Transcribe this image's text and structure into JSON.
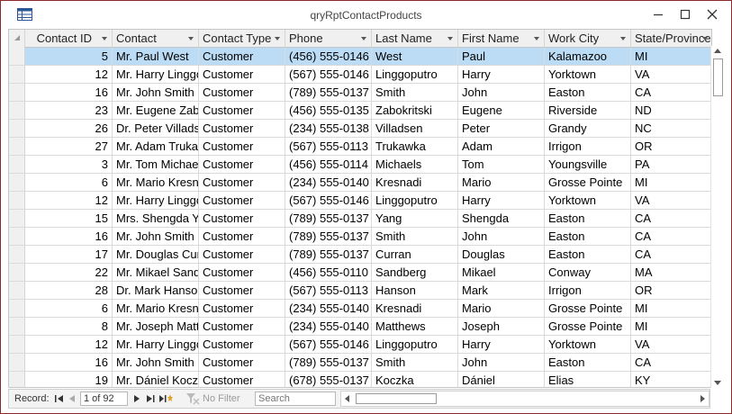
{
  "window": {
    "title": "qryRptContactProducts"
  },
  "columns": [
    "Contact ID",
    "Contact",
    "Contact Type",
    "Phone",
    "Last Name",
    "First Name",
    "Work City",
    "State/Province"
  ],
  "rows": [
    [
      "5",
      "Mr. Paul West",
      "Customer",
      "(456) 555-0146",
      "West",
      "Paul",
      "Kalamazoo",
      "MI"
    ],
    [
      "12",
      "Mr. Harry Linggoputro",
      "Customer",
      "(567) 555-0146",
      "Linggoputro",
      "Harry",
      "Yorktown",
      "VA"
    ],
    [
      "16",
      "Mr. John Smith",
      "Customer",
      "(789) 555-0137",
      "Smith",
      "John",
      "Easton",
      "CA"
    ],
    [
      "23",
      "Mr. Eugene Zabokritski",
      "Customer",
      "(456) 555-0135",
      "Zabokritski",
      "Eugene",
      "Riverside",
      "ND"
    ],
    [
      "26",
      "Dr. Peter Villadsen",
      "Customer",
      "(234) 555-0138",
      "Villadsen",
      "Peter",
      "Grandy",
      "NC"
    ],
    [
      "27",
      "Mr. Adam Trukawka",
      "Customer",
      "(567) 555-0113",
      "Trukawka",
      "Adam",
      "Irrigon",
      "OR"
    ],
    [
      "3",
      "Mr. Tom Michaels",
      "Customer",
      "(456) 555-0114",
      "Michaels",
      "Tom",
      "Youngsville",
      "PA"
    ],
    [
      "6",
      "Mr. Mario Kresnadi",
      "Customer",
      "(234) 555-0140",
      "Kresnadi",
      "Mario",
      "Grosse Pointe",
      "MI"
    ],
    [
      "12",
      "Mr. Harry Linggoputro",
      "Customer",
      "(567) 555-0146",
      "Linggoputro",
      "Harry",
      "Yorktown",
      "VA"
    ],
    [
      "15",
      "Mrs. Shengda Yang",
      "Customer",
      "(789) 555-0137",
      "Yang",
      "Shengda",
      "Easton",
      "CA"
    ],
    [
      "16",
      "Mr. John Smith",
      "Customer",
      "(789) 555-0137",
      "Smith",
      "John",
      "Easton",
      "CA"
    ],
    [
      "17",
      "Mr. Douglas Curran",
      "Customer",
      "(789) 555-0137",
      "Curran",
      "Douglas",
      "Easton",
      "CA"
    ],
    [
      "22",
      "Mr. Mikael Sandberg",
      "Customer",
      "(456) 555-0110",
      "Sandberg",
      "Mikael",
      "Conway",
      "MA"
    ],
    [
      "28",
      "Dr. Mark Hanson",
      "Customer",
      "(567) 555-0113",
      "Hanson",
      "Mark",
      "Irrigon",
      "OR"
    ],
    [
      "6",
      "Mr. Mario Kresnadi",
      "Customer",
      "(234) 555-0140",
      "Kresnadi",
      "Mario",
      "Grosse Pointe",
      "MI"
    ],
    [
      "8",
      "Mr. Joseph Matthews",
      "Customer",
      "(234) 555-0140",
      "Matthews",
      "Joseph",
      "Grosse Pointe",
      "MI"
    ],
    [
      "12",
      "Mr. Harry Linggoputro",
      "Customer",
      "(567) 555-0146",
      "Linggoputro",
      "Harry",
      "Yorktown",
      "VA"
    ],
    [
      "16",
      "Mr. John Smith",
      "Customer",
      "(789) 555-0137",
      "Smith",
      "John",
      "Easton",
      "CA"
    ],
    [
      "19",
      "Mr. Dániel Koczka",
      "Customer",
      "(678) 555-0137",
      "Koczka",
      "Dániel",
      "Elias",
      "KY"
    ]
  ],
  "selected_row": 0,
  "colors": {
    "selected_row": "#bcdcf5",
    "window_border": "#8a2a2a"
  },
  "navigation": {
    "record_label": "Record:",
    "record_position": "1 of 92",
    "filter_label": "No Filter",
    "search_placeholder": "Search"
  },
  "icons": [
    "datasheet-icon",
    "minimize-icon",
    "maximize-icon",
    "close-icon",
    "first-record-icon",
    "previous-record-icon",
    "next-record-icon",
    "last-record-icon",
    "new-record-icon",
    "filter-icon"
  ]
}
